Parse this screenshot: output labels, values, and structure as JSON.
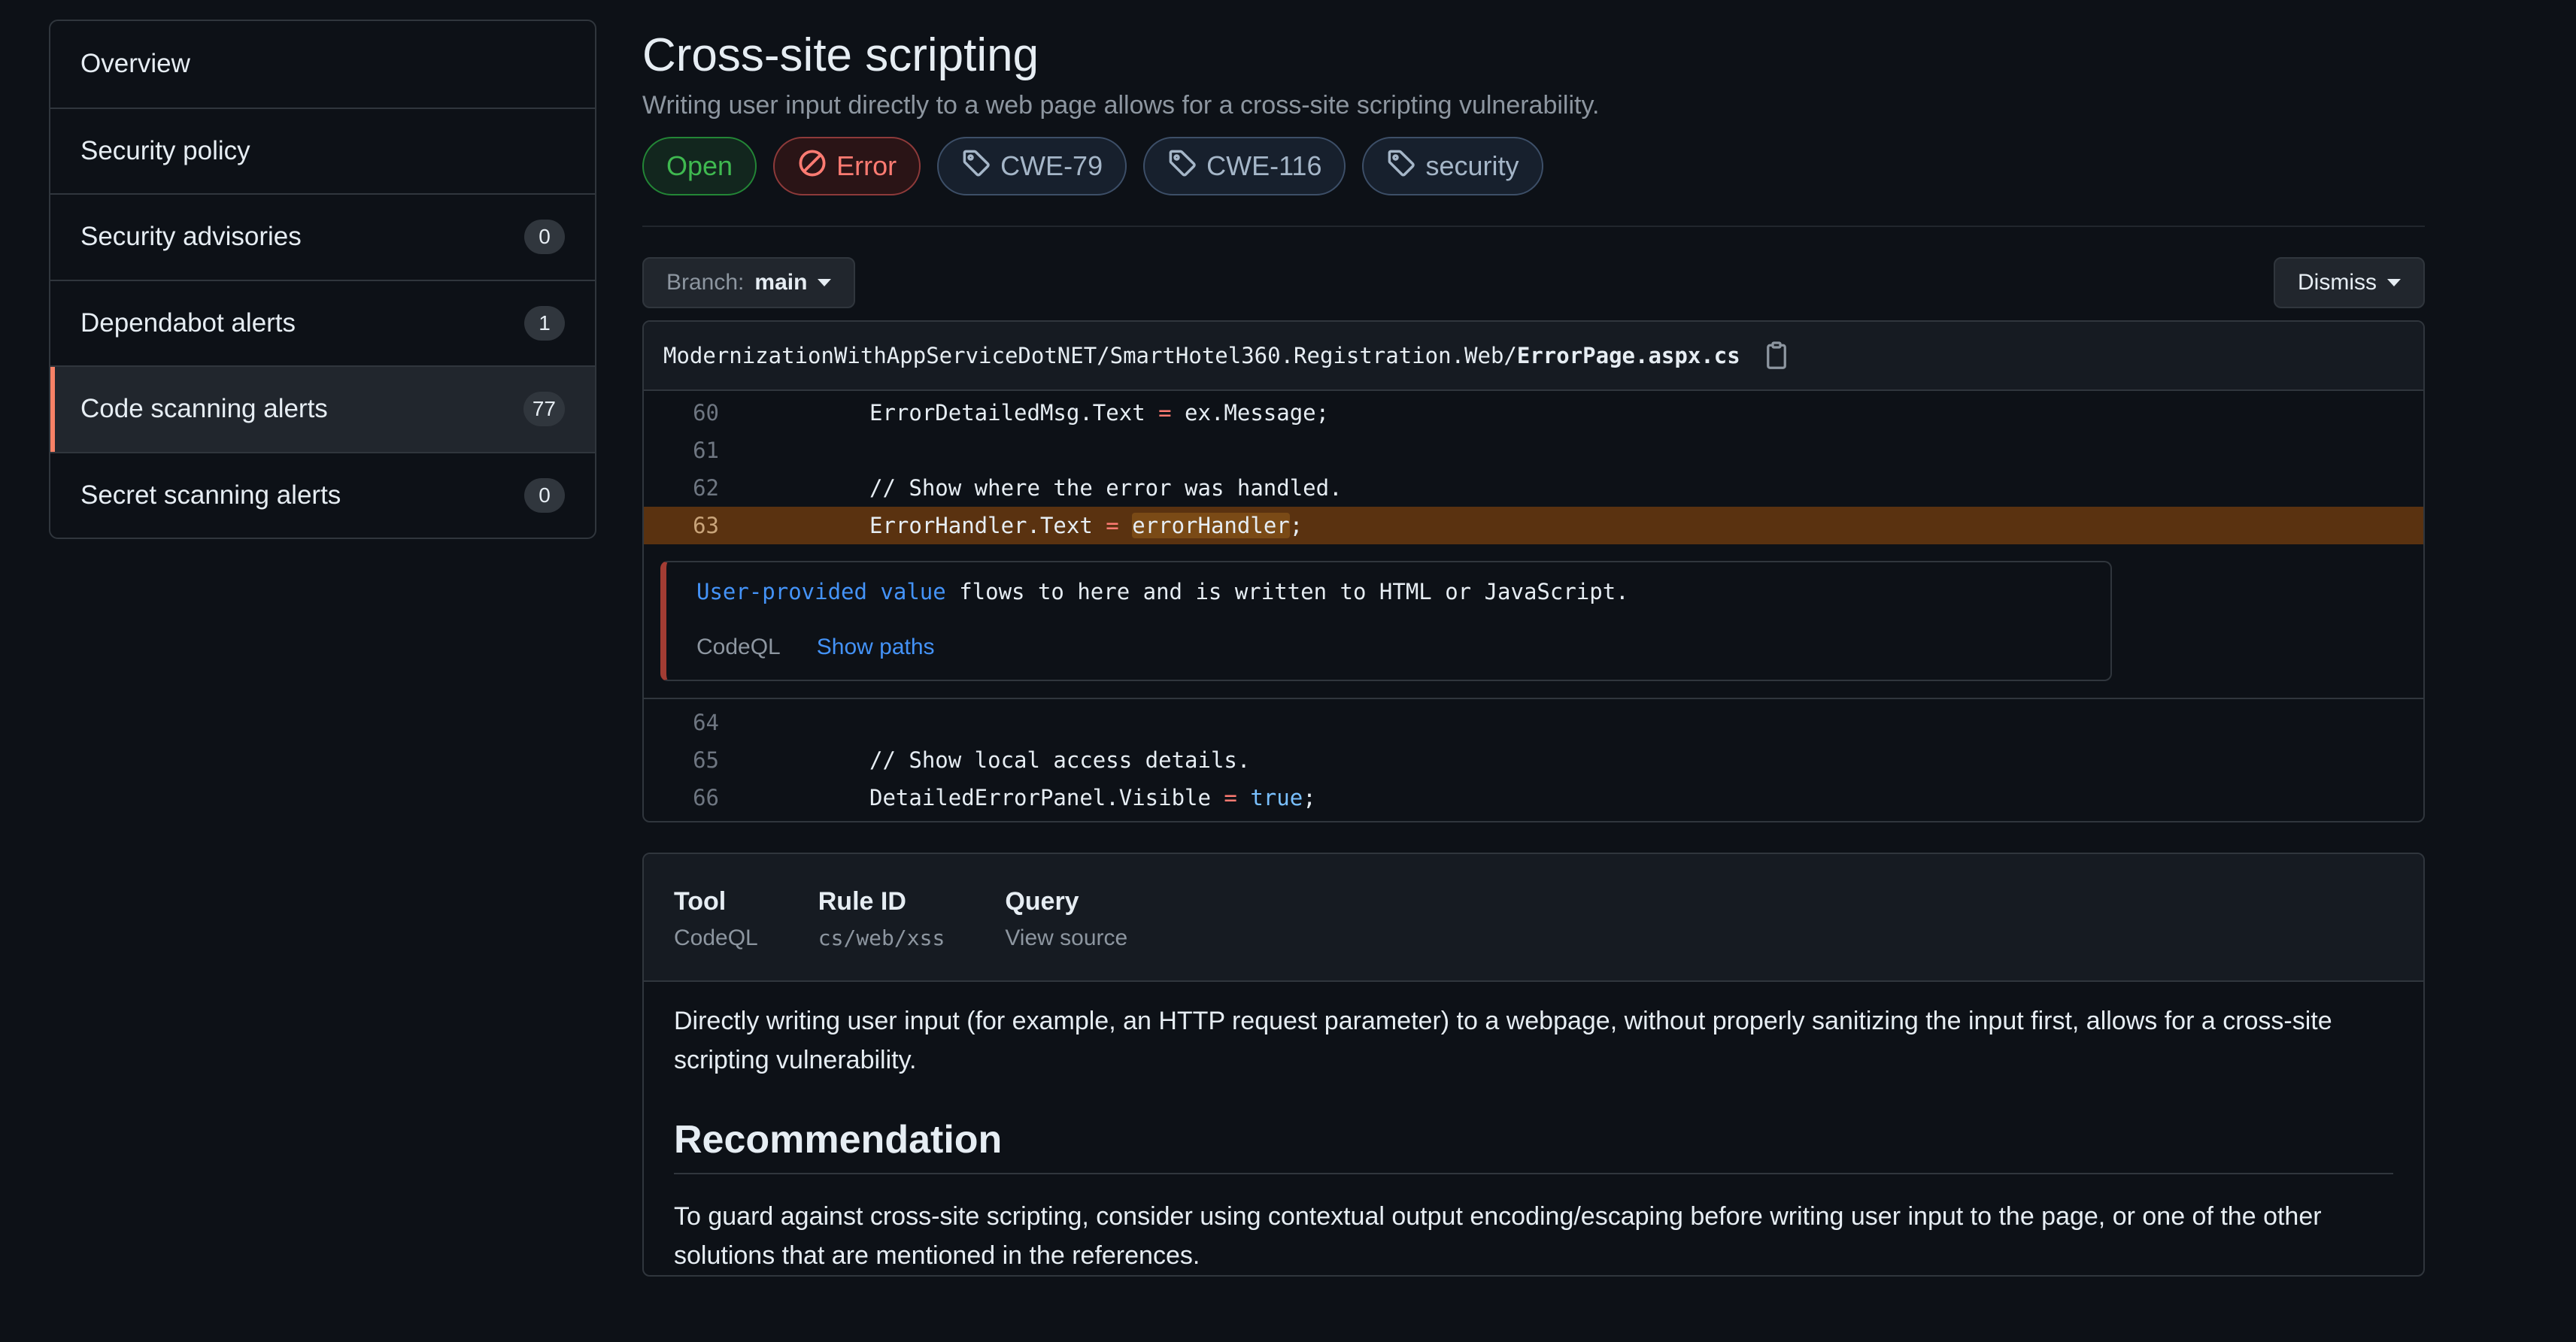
{
  "sidebar": {
    "items": [
      {
        "label": "Overview",
        "count": null
      },
      {
        "label": "Security policy",
        "count": null
      },
      {
        "label": "Security advisories",
        "count": "0"
      },
      {
        "label": "Dependabot alerts",
        "count": "1"
      },
      {
        "label": "Code scanning alerts",
        "count": "77",
        "active": true
      },
      {
        "label": "Secret scanning alerts",
        "count": "0"
      }
    ]
  },
  "alert": {
    "title": "Cross-site scripting",
    "subtitle": "Writing user input directly to a web page allows for a cross-site scripting vulnerability.",
    "labels": {
      "status": "Open",
      "severity": "Error",
      "tags": [
        "CWE-79",
        "CWE-116",
        "security"
      ]
    }
  },
  "toolbar": {
    "branch_prefix": "Branch:",
    "branch_name": "main",
    "dismiss_label": "Dismiss"
  },
  "code": {
    "path_prefix": "ModernizationWithAppServiceDotNET/SmartHotel360.Registration.Web/",
    "file_name": "ErrorPage.aspx.cs",
    "lines_before": [
      {
        "num": "60",
        "text": "ErrorDetailedMsg.Text = ex.Message;"
      },
      {
        "num": "61",
        "text": ""
      },
      {
        "num": "62",
        "text": "// Show where the error was handled."
      },
      {
        "num": "63",
        "text": "ErrorHandler.Text = errorHandler;"
      }
    ],
    "lines_after": [
      {
        "num": "64",
        "text": ""
      },
      {
        "num": "65",
        "text": "// Show local access details."
      },
      {
        "num": "66",
        "text": "DetailedErrorPanel.Visible = true;"
      }
    ],
    "highlight_line": "63",
    "message": {
      "link": "User-provided value",
      "rest": " flows to here and is written to HTML or JavaScript."
    },
    "tool": "CodeQL",
    "show_paths": "Show paths"
  },
  "details": {
    "tool_label": "Tool",
    "tool_value": "CodeQL",
    "rule_label": "Rule ID",
    "rule_value": "cs/web/xss",
    "query_label": "Query",
    "query_value": "View source",
    "description": "Directly writing user input (for example, an HTTP request parameter) to a webpage, without properly sanitizing the input first, allows for a cross-site scripting vulnerability.",
    "recommendation_heading": "Recommendation",
    "recommendation": "To guard against cross-site scripting, consider using contextual output encoding/escaping before writing user input to the page, or one of the other solutions that are mentioned in the references."
  },
  "colors": {
    "accent_active": "#f78166",
    "open_green": "#3fb950",
    "error_red": "#ff7b72",
    "link_blue": "#4493f8",
    "highlight_line": "#5a3210"
  }
}
